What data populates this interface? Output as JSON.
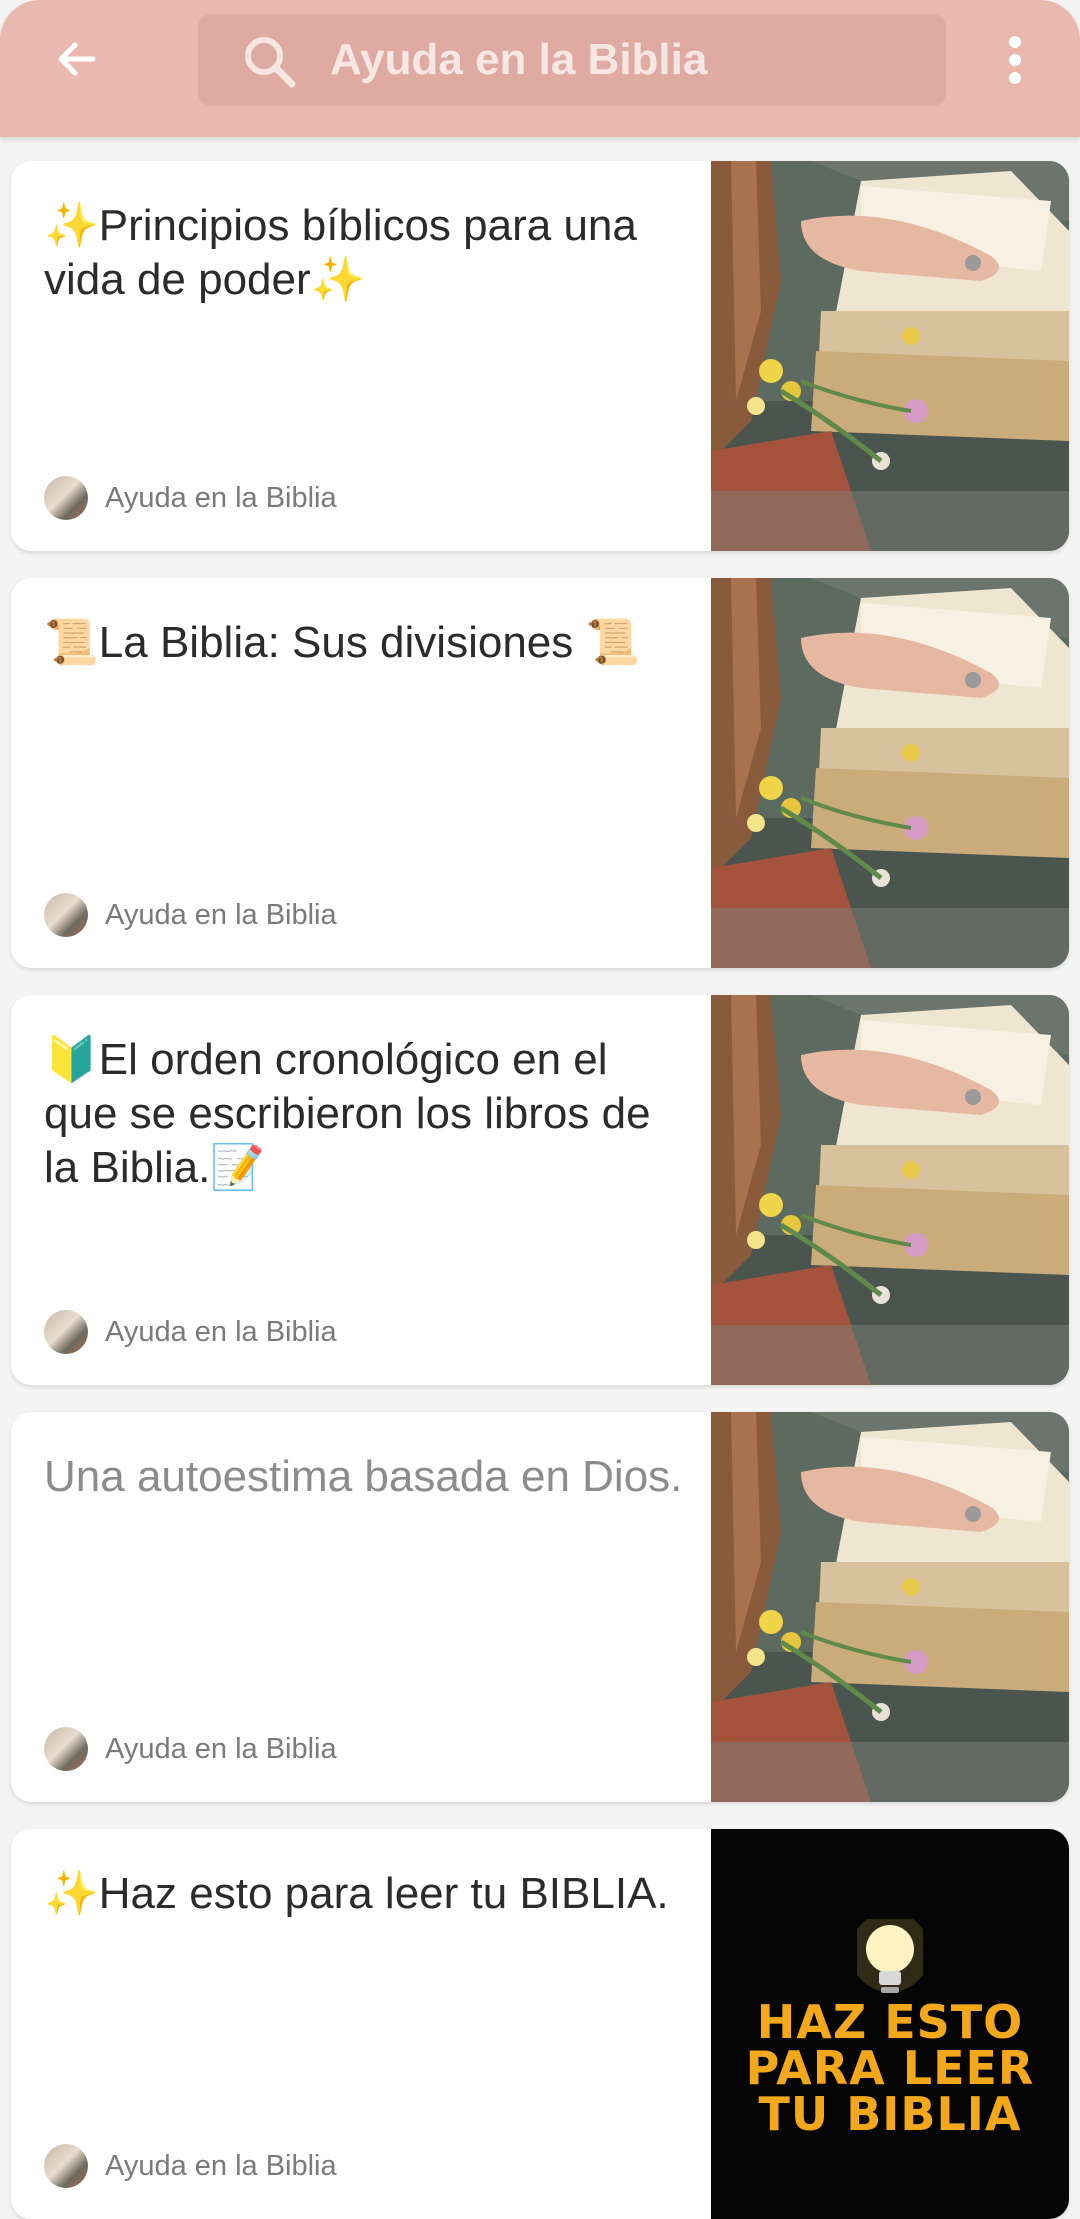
{
  "header": {
    "search_text": "Ayuda en la Biblia",
    "back_icon": "arrow-left-icon",
    "search_icon": "search-icon",
    "more_icon": "more-vertical-icon",
    "background_color": "#e9b8ae"
  },
  "cards": [
    {
      "title": "✨Principios bíblicos para una vida de poder✨",
      "author": "Ayuda en la Biblia",
      "read": false
    },
    {
      "title": "📜La Biblia: Sus divisiones 📜",
      "author": "Ayuda en la Biblia",
      "read": false
    },
    {
      "title": "🔰El orden cronológico en el que se escribieron los libros de la Biblia.📝",
      "author": "Ayuda en la Biblia",
      "read": false
    },
    {
      "title": "Una autoestima basada en Dios.",
      "author": "Ayuda en la Biblia",
      "read": true
    },
    {
      "title": "✨Haz esto para leer tu BIBLIA.",
      "author": "Ayuda en la Biblia",
      "read": false,
      "thumb_lines": [
        "HAZ ESTO",
        "PARA LEER",
        "TU BIBLIA"
      ]
    }
  ]
}
